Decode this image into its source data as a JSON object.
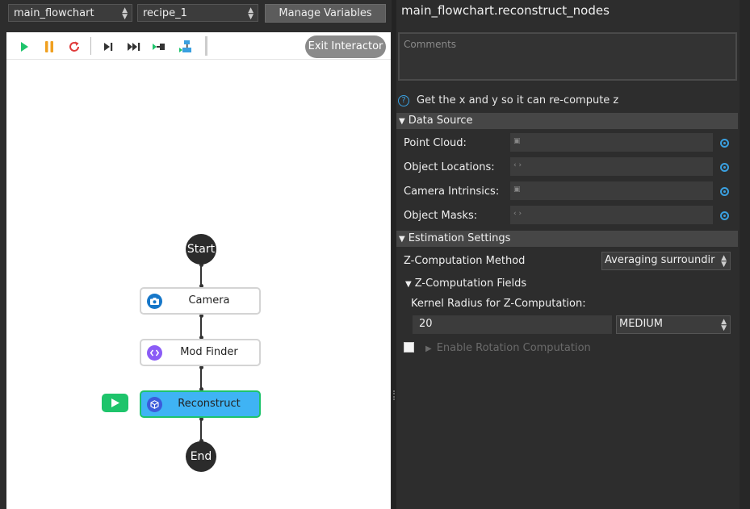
{
  "top_bar": {
    "flowchart_select": "main_flowchart",
    "recipe_select": "recipe_1",
    "manage_variables_label": "Manage Variables"
  },
  "toolbar": {
    "icons": [
      "play-icon",
      "pause-icon",
      "restart-icon",
      "step-icon",
      "step-to-end-icon",
      "step-into-icon",
      "step-over-node-icon"
    ],
    "exit_interactor_label": "Exit Interactor"
  },
  "flowchart": {
    "start_label": "Start",
    "end_label": "End",
    "nodes": [
      {
        "label": "Camera",
        "icon": "camera-icon",
        "icon_color": "#1677c9"
      },
      {
        "label": "Mod Finder",
        "icon": "code-icon",
        "icon_color": "#8b5cf6"
      },
      {
        "label": "Reconstruct",
        "icon": "cube-icon",
        "icon_color": "#3b5bdb",
        "active": true
      }
    ],
    "active_fill": "#3fb3f4",
    "active_border": "#1ec46b"
  },
  "properties": {
    "title": "main_flowchart.reconstruct_nodes",
    "comments_placeholder": "Comments",
    "description": "Get the x and y so it can re-compute z",
    "data_source": {
      "header": "Data Source",
      "fields": [
        {
          "label": "Point Cloud:",
          "icon": "camera-icon"
        },
        {
          "label": "Object Locations:",
          "icon": "code-icon"
        },
        {
          "label": "Camera Intrinsics:",
          "icon": "camera-icon"
        },
        {
          "label": "Object Masks:",
          "icon": "code-icon"
        }
      ]
    },
    "estimation": {
      "header": "Estimation Settings",
      "z_method_label": "Z-Computation Method",
      "z_method_value": "Averaging surroundir",
      "z_fields_header": "Z-Computation Fields",
      "kernel_label": "Kernel Radius for Z-Computation:",
      "kernel_value": "20",
      "kernel_preset": "MEDIUM",
      "enable_rotation_label": "Enable Rotation Computation",
      "enable_rotation_checked": false
    }
  }
}
